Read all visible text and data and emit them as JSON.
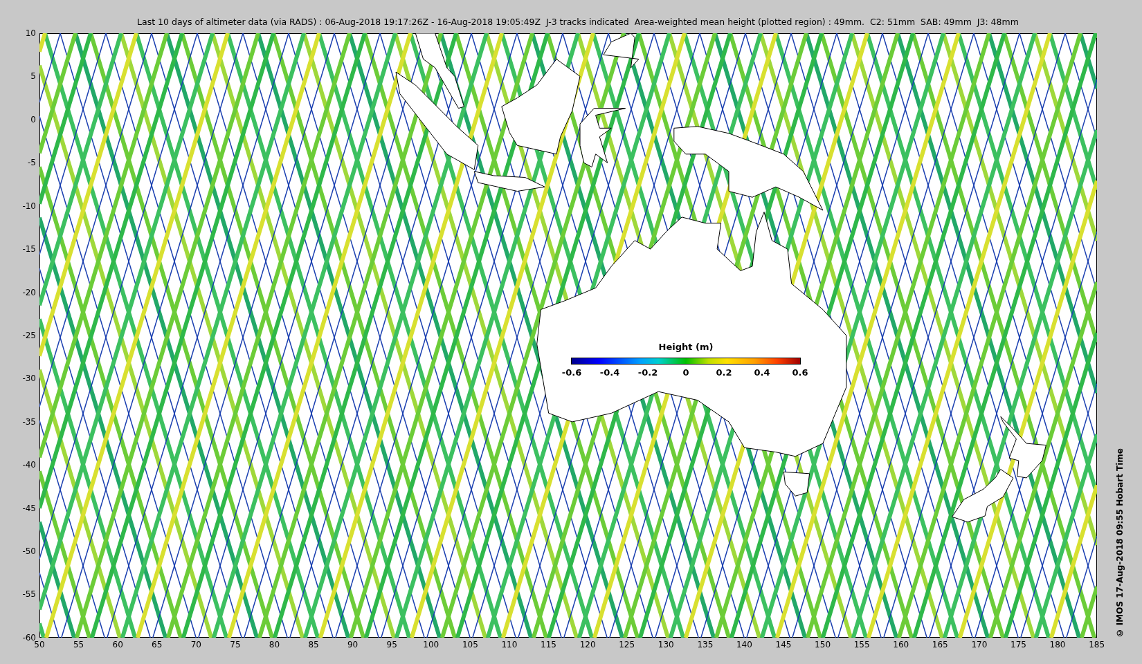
{
  "figure": {
    "title": "Last 10 days of altimeter data (via RADS) : 06-Aug-2018 19:17:26Z - 16-Aug-2018 19:05:49Z  J-3 tracks indicated  Area-weighted mean height (plotted region) : 49mm.  C2: 51mm  SAB: 49mm  J3: 48mm",
    "y_axis_labels": [
      "10",
      "5",
      "0",
      "-5",
      "-10",
      "-15",
      "-20",
      "-25",
      "-30",
      "-35",
      "-40",
      "-45",
      "-50",
      "-55",
      "-60"
    ],
    "x_axis_labels": [
      "50",
      "55",
      "60",
      "65",
      "70",
      "75",
      "80",
      "85",
      "90",
      "95",
      "100",
      "105",
      "110",
      "115",
      "120",
      "125",
      "130",
      "135",
      "140",
      "145",
      "150",
      "155",
      "160",
      "165",
      "170",
      "175",
      "180",
      "185"
    ],
    "colorbar": {
      "title": "Height (m)",
      "tick_labels": [
        "-0.6",
        "-0.4",
        "-0.2",
        "0",
        "0.2",
        "0.4",
        "0.6"
      ]
    },
    "credit": "© IMOS 17-Aug-2018 09:55 Hobart Time"
  }
}
